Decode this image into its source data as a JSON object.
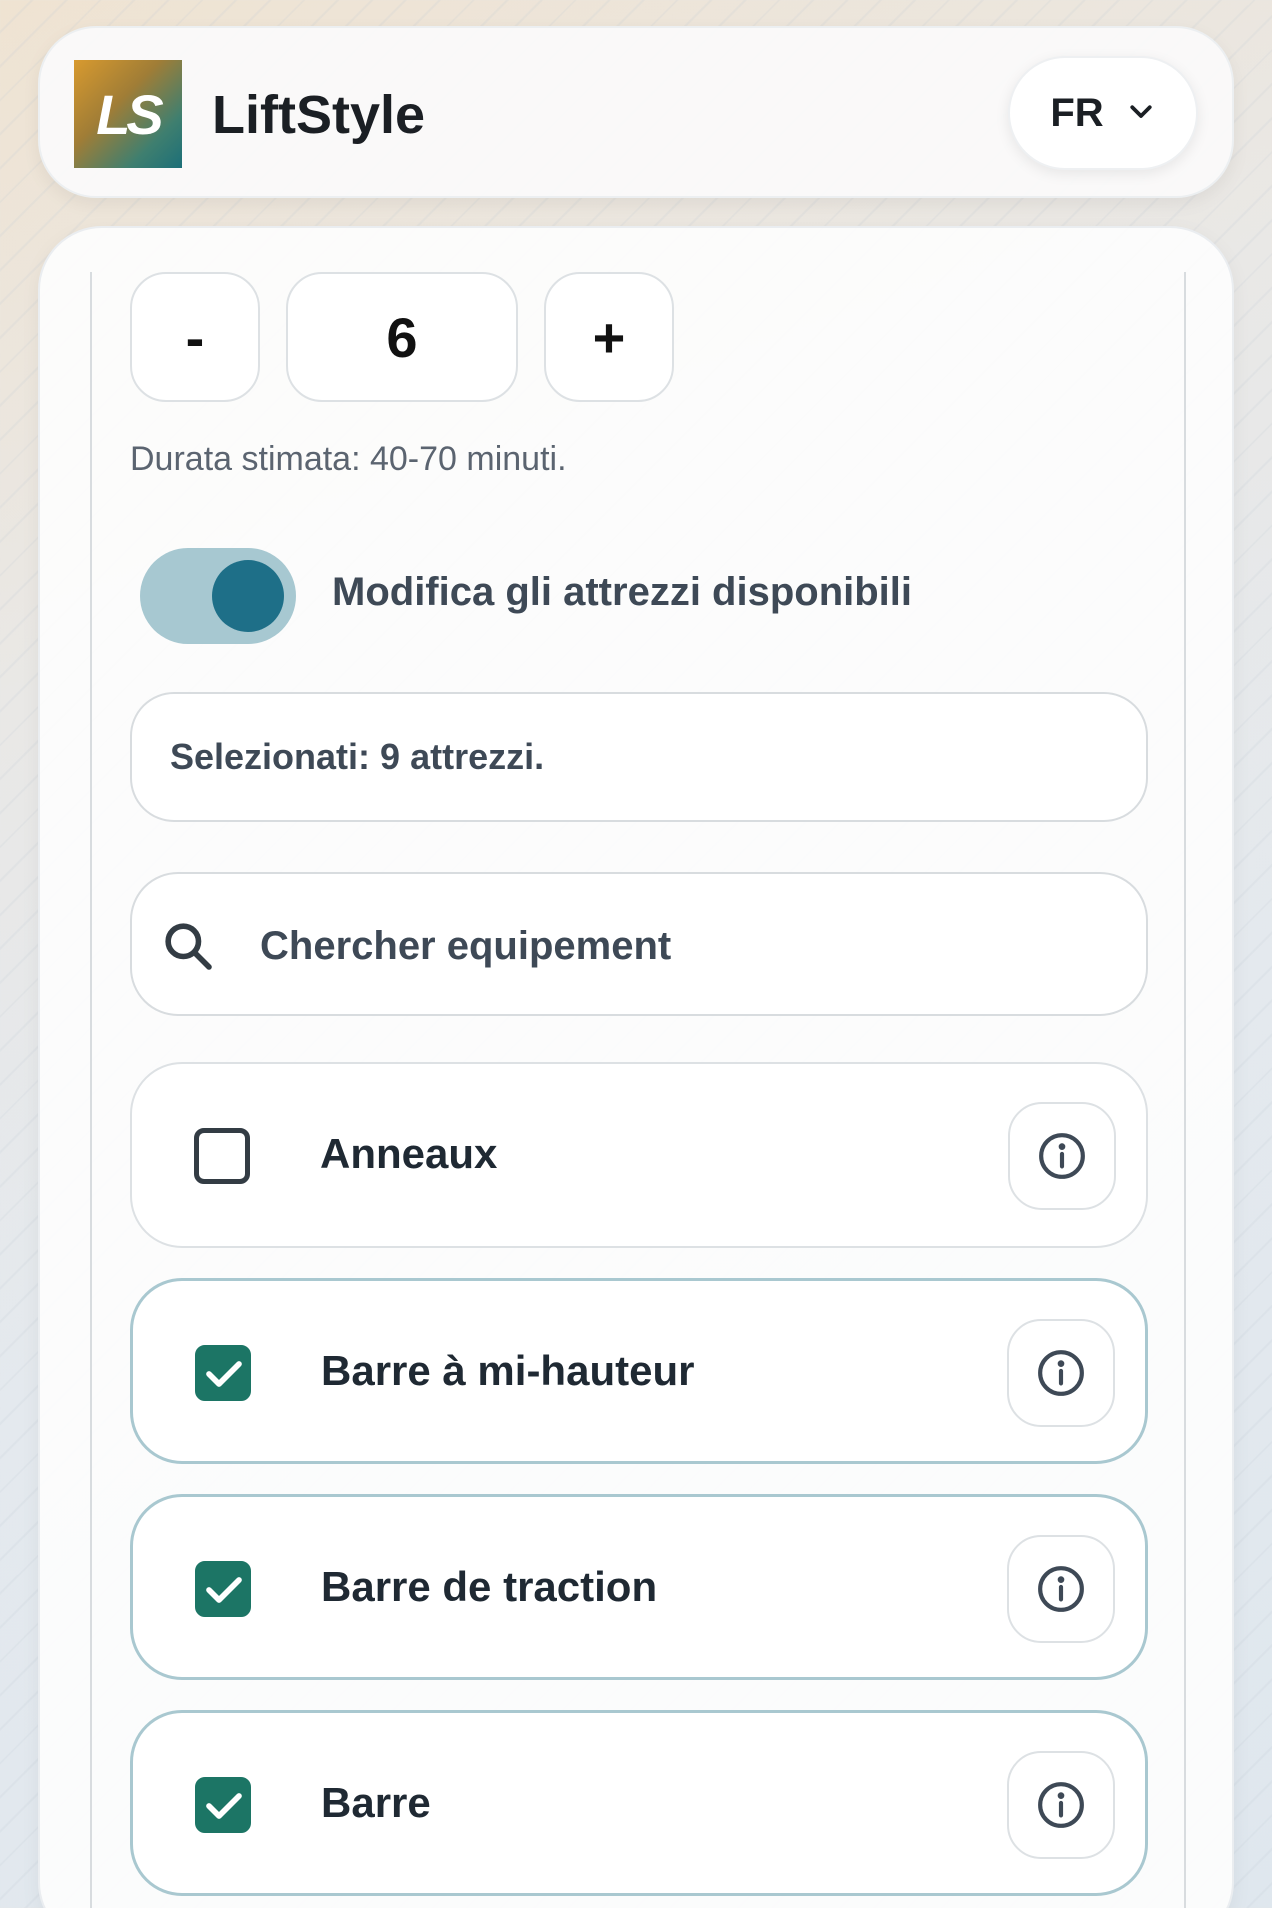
{
  "header": {
    "logo_text": "LS",
    "app_title": "LiftStyle",
    "language": "FR"
  },
  "stepper": {
    "decrement_label": "-",
    "value": "6",
    "increment_label": "+"
  },
  "duration_text": "Durata stimata: 40-70 minuti.",
  "equipment_toggle": {
    "label": "Modifica gli attrezzi disponibili",
    "on": true
  },
  "selected_text": "Selezionati: 9 attrezzi.",
  "search": {
    "placeholder": "Chercher equipement",
    "value": ""
  },
  "equipment": [
    {
      "label": "Anneaux",
      "checked": false
    },
    {
      "label": "Barre à mi-hauteur",
      "checked": true
    },
    {
      "label": "Barre de traction",
      "checked": true
    },
    {
      "label": "Barre",
      "checked": true
    }
  ],
  "colors": {
    "accent": "#1e6f88",
    "checkbox": "#1c7565",
    "toggle_track": "#a7c8d1"
  }
}
